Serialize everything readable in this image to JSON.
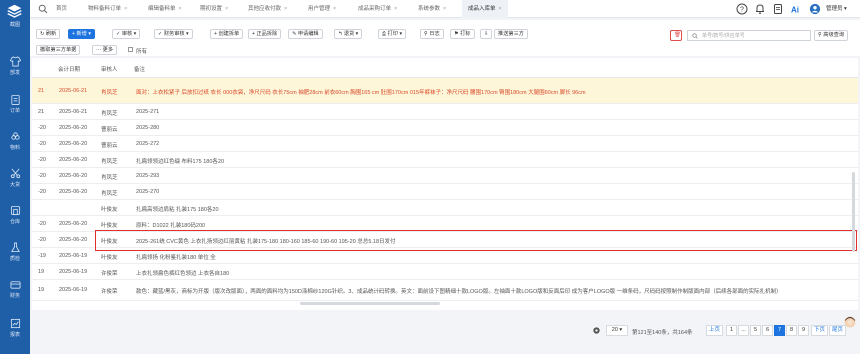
{
  "sidebar": {
    "items": [
      {
        "label": "截图",
        "icon": "layers-icon"
      },
      {
        "label": "部发",
        "icon": "shirt-icon"
      },
      {
        "label": "订单",
        "icon": "clipboard-icon"
      },
      {
        "label": "物料",
        "icon": "flower-icon"
      },
      {
        "label": "大货",
        "icon": "scissors-icon"
      },
      {
        "label": "仓库",
        "icon": "warehouse-icon"
      },
      {
        "label": "质检",
        "icon": "flask-icon"
      },
      {
        "label": "财务",
        "icon": "finance-icon"
      },
      {
        "label": "报表",
        "icon": "chart-icon"
      }
    ]
  },
  "tabs": [
    {
      "label": "首页"
    },
    {
      "label": "物料备料订单"
    },
    {
      "label": "编辑备料单"
    },
    {
      "label": "期初设置"
    },
    {
      "label": "其他应收付款"
    },
    {
      "label": "用户管理"
    },
    {
      "label": "成品采购订单"
    },
    {
      "label": "系统参数"
    },
    {
      "label": "成品入库单"
    }
  ],
  "user": {
    "name": "管理员"
  },
  "toolbar": {
    "refresh": "刷新",
    "new": "新增",
    "audit": "审核",
    "fin_audit": "财务审核",
    "create_split": "创建拆单",
    "positive_split": "正品拆除",
    "apply_edit": "申请编辑",
    "return": "退货",
    "print": "打印",
    "log": "日志",
    "mark": "打标",
    "push_third": "推送第三方",
    "cancel_third": "撤取第三方单据",
    "more": "更多",
    "all": "所有",
    "search_placeholder": "单号/款号/供应单号",
    "advanced": "高级查询"
  },
  "table": {
    "headers": [
      "会计日期",
      "审核人",
      "备注"
    ],
    "rows": [
      {
        "prefix": "21",
        "date": "2025-06-21",
        "auditor": "肖凤芝",
        "note": "面对：上衣松紧子 后放扣过纸 衣长 000衣袋，净尺尺码 衣长75cm 袖肥28cm 前衣60cm 胸围165 cm 肚围170cm 015年裤袜子：净尺尺码 腰围170cm 臀围180cm 大腿围60cm 脚长 96cm"
      },
      {
        "prefix": "21",
        "date": "2025-06-21",
        "auditor": "肖凤芝",
        "note": "2025-271"
      },
      {
        "prefix": "-20",
        "date": "2025-06-20",
        "auditor": "曹丽云",
        "note": "2025-280"
      },
      {
        "prefix": "-20",
        "date": "2025-06-20",
        "auditor": "曹丽云",
        "note": "2025-272"
      },
      {
        "prefix": "-20",
        "date": "2025-06-20",
        "auditor": "肖凤芝",
        "note": "扎扁领领边红色缀 布料175 180各20"
      },
      {
        "prefix": "-20",
        "date": "2025-06-20",
        "auditor": "肖凤芝",
        "note": "2025-293"
      },
      {
        "prefix": "-20",
        "date": "2025-06-20",
        "auditor": "肖凤芝",
        "note": "2025-270"
      },
      {
        "prefix": "",
        "date": "",
        "auditor": "叶俊友",
        "note": "扎扁高领边肩粘 扎装175 180各20"
      },
      {
        "prefix": "-20",
        "date": "2025-06-20",
        "auditor": "叶俊友",
        "note": "原料：D1022 扎装180码200"
      },
      {
        "prefix": "-20",
        "date": "2025-06-20",
        "auditor": "叶俊友",
        "note": "2025-261统 CVC黄色 上衣扎扬领边红丽黄粘 扎装175-180 180-160 185-60 190-60 195-20 总总5.18日发付"
      },
      {
        "prefix": "-19",
        "date": "2025-06-19",
        "auditor": "叶俊友",
        "note": "扎扁领扬 化粉鉴扎装180 单位 全"
      },
      {
        "prefix": "19",
        "date": "2025-06-19",
        "auditor": "许俊荣",
        "note": "上衣扎领扁色裤红色领边 上衣各自180"
      },
      {
        "prefix": "19",
        "date": "2025-06-19",
        "auditor": "许俊荣",
        "note": "款色：藏蓝/黑灰，商标为开版（版次改版面），两面的面料均为150D涤棉纱120G针织。3、成品统计码转换。英文：面前设下图精细十款LOGO版。左袖面十款LOGO版和反面后印 成为客户LOGO版 一维条码，尺码码按照制作制版面内部（后续各部面的实际扎机制）"
      }
    ]
  },
  "pagination": {
    "page_size": "20",
    "summary": "第121至140条，共164条",
    "prev": "上页",
    "pages": [
      "1",
      "...",
      "5",
      "6",
      "7",
      "8",
      "9"
    ],
    "active_page": "7",
    "next": "下页",
    "last": "尾页"
  },
  "colors": {
    "sidebar_bg": "#1f5fa8",
    "primary": "#1d74e0",
    "highlight_row": "#fdf6d9",
    "highlight_text": "#d94b2a",
    "red_box": "#e02f2f"
  }
}
